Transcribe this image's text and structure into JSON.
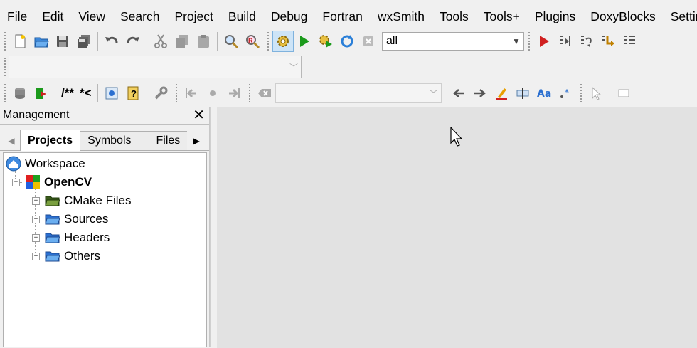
{
  "menubar": {
    "items": [
      "File",
      "Edit",
      "View",
      "Search",
      "Project",
      "Build",
      "Debug",
      "Fortran",
      "wxSmith",
      "Tools",
      "Tools+",
      "Plugins",
      "DoxyBlocks",
      "Settings"
    ]
  },
  "toolbar_main": {
    "build_target": "all",
    "icons": [
      "new-file-icon",
      "open-icon",
      "save-icon",
      "save-all-icon",
      "undo-icon",
      "redo-icon",
      "cut-icon",
      "copy-icon",
      "paste-icon",
      "find-icon",
      "replace-icon",
      "build-gear-icon",
      "run-icon",
      "build-run-icon",
      "rebuild-icon",
      "abort-icon"
    ]
  },
  "toolbar_debug": {
    "icons": [
      "debug-start-icon",
      "run-to-cursor-icon",
      "next-line-icon",
      "step-into-icon"
    ]
  },
  "toolbar_doxy": {
    "comment_block_label": "/**",
    "comment_line_label": "*<"
  },
  "management": {
    "title": "Management",
    "tabs": [
      "Projects",
      "Symbols",
      "Files"
    ],
    "active_tab": "Projects",
    "tree": {
      "workspace": "Workspace",
      "project": "OpenCV",
      "folders": [
        "CMake Files",
        "Sources",
        "Headers",
        "Others"
      ]
    }
  },
  "colors": {
    "accent_blue": "#2a6fd0",
    "run_green": "#1b9a1b",
    "stop_red": "#d02020",
    "editor_bg": "#e2e2e2"
  }
}
